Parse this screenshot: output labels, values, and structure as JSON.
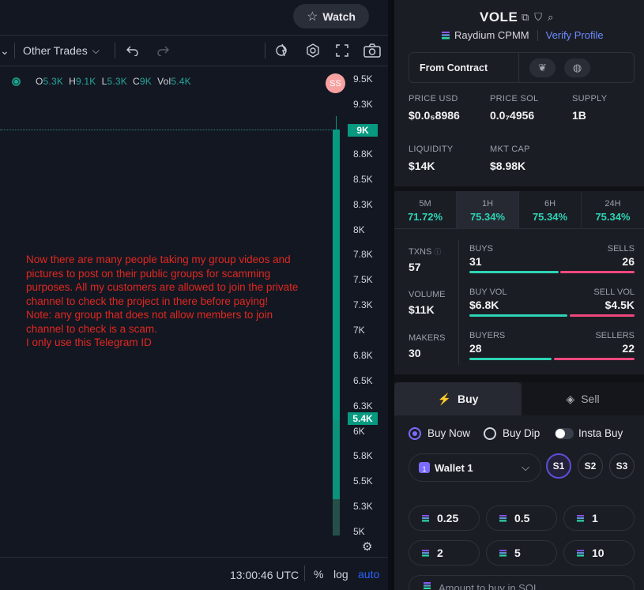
{
  "chart": {
    "watch_label": "Watch",
    "toolbar": {
      "trades_dropdown": "Other Trades"
    },
    "ohlc": {
      "o_label": "O",
      "o": "5.3K",
      "h_label": "H",
      "h": "9.1K",
      "l_label": "L",
      "l": "5.3K",
      "c_label": "C",
      "c": "9K",
      "vol_label": "Vol",
      "vol": "5.4K"
    },
    "avatar": "SS",
    "price_ticks": [
      "9.5K",
      "9.3K",
      "8.8K",
      "8.5K",
      "8.3K",
      "8K",
      "7.8K",
      "7.5K",
      "7.3K",
      "7K",
      "6.8K",
      "6.5K",
      "6.3K",
      "6K",
      "5.8K",
      "5.5K",
      "5.3K",
      "5K"
    ],
    "last_price_tag": "9K",
    "volume_tag": "5.4K",
    "overlay_message": [
      "Now there are many people taking my group videos and",
      "pictures to post on their public groups for scamming",
      "purposes. All my customers are allowed to join the private",
      "channel to check the project in there before paying!",
      "Note: any group that does not allow members to join",
      "channel to check is a scam.",
      "I only use this Telegram ID"
    ],
    "bottom": {
      "time": "13:00:46 UTC",
      "percent": "%",
      "log": "log",
      "auto": "auto"
    }
  },
  "token": {
    "symbol": "VOLE",
    "dex": "Raydium CPMM",
    "verify": "Verify Profile",
    "contract_label": "From Contract",
    "stats": [
      {
        "label": "PRICE USD",
        "value": "$0.0₅8986"
      },
      {
        "label": "PRICE SOL",
        "value": "0.0₇4956"
      },
      {
        "label": "SUPPLY",
        "value": "1B"
      },
      {
        "label": "LIQUIDITY",
        "value": "$14K"
      },
      {
        "label": "MKT CAP",
        "value": "$8.98K"
      }
    ]
  },
  "timeframes": [
    {
      "label": "5M",
      "value": "71.72%"
    },
    {
      "label": "1H",
      "value": "75.34%"
    },
    {
      "label": "6H",
      "value": "75.34%"
    },
    {
      "label": "24H",
      "value": "75.34%"
    }
  ],
  "activity": {
    "txns_label": "TXNS",
    "txns": "57",
    "volume_label": "VOLUME",
    "volume": "$11K",
    "makers_label": "MAKERS",
    "makers": "30",
    "buys_label": "BUYS",
    "buys": "31",
    "sells_label": "SELLS",
    "sells": "26",
    "buy_vol_label": "BUY VOL",
    "buy_vol": "$6.8K",
    "sell_vol_label": "SELL VOL",
    "sell_vol": "$4.5K",
    "buyers_label": "BUYERS",
    "buyers": "28",
    "sellers_label": "SELLERS",
    "sellers": "22"
  },
  "trade": {
    "tab_buy": "Buy",
    "tab_sell": "Sell",
    "opt_buy_now": "Buy Now",
    "opt_buy_dip": "Buy Dip",
    "opt_insta": "Insta Buy",
    "wallet": "Wallet 1",
    "wallet_badge": "1",
    "slots": [
      "S1",
      "S2",
      "S3"
    ],
    "amounts": [
      "0.25",
      "0.5",
      "1",
      "2",
      "5",
      "10"
    ],
    "amount_placeholder": "Amount to buy in SOL"
  },
  "colors": {
    "up": "#089981",
    "down": "#f0487d",
    "accent": "#7b6cff",
    "warning_text": "#e0281f"
  }
}
